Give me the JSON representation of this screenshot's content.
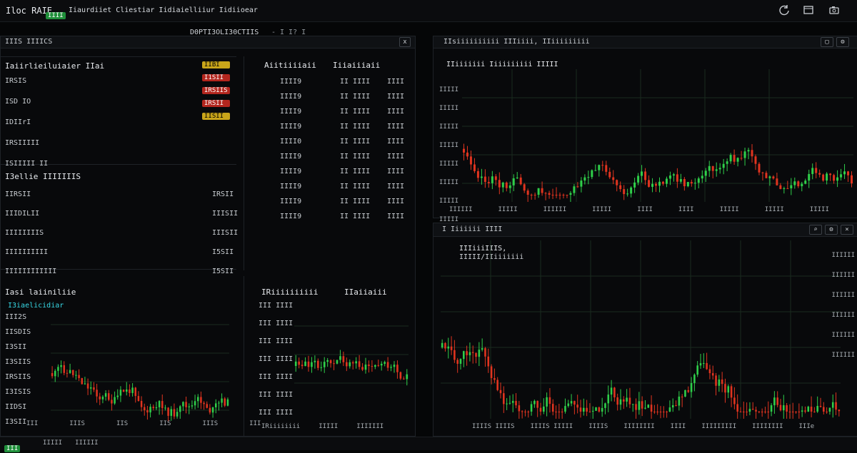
{
  "app": {
    "title": "Iloc RAIE",
    "tab_badge": "IIII",
    "subtitle": "Iiaurdiiet Cliestiar Iidiaielliiur Iidiioear",
    "address": "D0PTI3OLI30CTIIS",
    "nav_suffix": "- I I?  I"
  },
  "top_right_icons": [
    "refresh-icon",
    "window-icon",
    "camera-icon"
  ],
  "left_panel": {
    "title": "IIIS IIIICS",
    "close_hint": "x",
    "section1": {
      "title": "Iaiirlieiluiaier IIai",
      "rows": [
        "IRSIS",
        "ISD IO",
        "IDIIrI",
        "IRSIIIII",
        "ISIIIII II"
      ],
      "badge_values": [
        "IIBI",
        "I1SII",
        "IRSIIS",
        "IRSII",
        "IISII"
      ]
    },
    "section2": {
      "title": "I3ellie IIIIIIIS",
      "rows": [
        "IIRSII",
        "IIIDILII",
        "IIIIIIIIS",
        "IIIIIIIIII",
        "IIIIIIIIIIII"
      ],
      "values": [
        "IRSII",
        "IIISII",
        "IIISII",
        "I5SII",
        "I5SII"
      ]
    },
    "section3": {
      "title": "Iasi laiiniliie",
      "chart_title": "I3iaelicidiar",
      "rows": [
        "III2S",
        "IISDIS",
        "I3SII",
        "I3SIIS",
        "IRSIIS",
        "I3ISIS",
        "IIDSI",
        "I3SII"
      ],
      "footer": [
        "III",
        "IIIS",
        "IIS",
        "IIS",
        "IIIS",
        "III"
      ]
    }
  },
  "mid_panel": {
    "col1": {
      "title": "Aiitiiiiaii",
      "values": [
        "IIII9",
        "IIII9",
        "IIII9",
        "IIII9",
        "IIII0",
        "IIII9",
        "IIII9",
        "IIII9",
        "IIII9",
        "IIII9"
      ]
    },
    "col2": {
      "title": "Iiiaiiiaii",
      "values": [
        "II IIII",
        "II IIII",
        "II IIII",
        "II IIII",
        "II IIII",
        "II IIII",
        "II IIII",
        "II IIII",
        "II IIII",
        "II IIII"
      ]
    },
    "col3": {
      "values": [
        "IIII",
        "IIII",
        "IIII",
        "IIII",
        "IIII",
        "IIII",
        "IIII",
        "IIII",
        "IIII",
        "IIII"
      ]
    },
    "bottom": {
      "title": "IRiiiiiiiiii",
      "title2": "IIaiiaiii",
      "rows": [
        "III IIII",
        "III IIII",
        "III IIII",
        "III IIII",
        "III IIII",
        "III IIII",
        "III IIII"
      ],
      "footer": [
        "IRiiiiiiii",
        "IIIII",
        "IIIIIII"
      ]
    }
  },
  "right_top": {
    "title": "IIsiiiiiiiiii IIIiiii, IIiiiiiiiii",
    "subtitle": "IIiiiiiii Iiiiiiiiii IIIII",
    "yticks": [
      "IIIII",
      "IIIII",
      "IIIII",
      "IIIII",
      "IIIII",
      "IIIII",
      "IIIII",
      "IIIII"
    ],
    "xticks": [
      "IIIIII",
      "IIIII",
      "IIIIII",
      "IIIII",
      "IIII",
      "IIII",
      "IIIII",
      "IIIII",
      "IIIII"
    ]
  },
  "right_bottom": {
    "title": "I Iiiiiii IIII",
    "legend1": "IIIiiiIIIS,",
    "legend2": "IIIII/IIiiiiiii",
    "xticks": [
      "IIIIS IIIIS",
      "IIIIS IIIII",
      "IIIIS",
      "IIIIIIII",
      "IIII",
      "IIIIIIIII",
      "IIIIIIII",
      "IIIe"
    ],
    "right_axis": [
      "IIIIII",
      "IIIIII",
      "IIIIII",
      "IIIIII",
      "IIIIII",
      "IIIIII"
    ]
  },
  "statusbar": {
    "left": "III",
    "items": [
      "IIIII",
      "IIIIII"
    ]
  },
  "colors": {
    "up": "#2fcf4a",
    "down": "#e0341f",
    "neutral": "#c9cdd2",
    "accent_yellow": "#d9b11d",
    "accent_blue": "#1f66c9",
    "bg": "#050607"
  }
}
